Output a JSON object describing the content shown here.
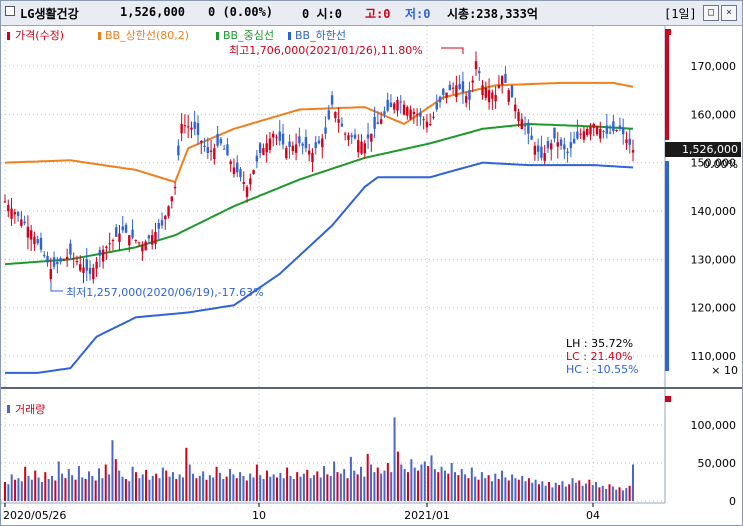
{
  "title_bar": {
    "stock_name": "LG생활건강",
    "price": "1,526,000",
    "change": "0 (0.00%)",
    "open_label": "0  시:0",
    "high_label": "고:0",
    "low_label": "저:0",
    "market_cap": "시총:238,333억",
    "period_button": "[1일]",
    "icon_restore": "restore-icon",
    "icon_close": "close-icon"
  },
  "colors": {
    "price": "#d0021b",
    "upper": "#f07f1f",
    "middle": "#1a9a2a",
    "lower": "#2f63d6",
    "volume": "#4a66c8",
    "grid": "#c0c8d4"
  },
  "legend": [
    {
      "label": "가격(수정)",
      "color": "#d0021b"
    },
    {
      "label": "BB_상한선(80,2)",
      "color": "#f07f1f"
    },
    {
      "label": "BB_중심선",
      "color": "#1a9a2a"
    },
    {
      "label": "BB_하한선",
      "color": "#2f63d6"
    }
  ],
  "annotations": {
    "max": "최고1,706,000(2021/01/26),11.80%",
    "min": "최저1,257,000(2020/06/19),-17.63%",
    "lh": "LH :  35.72%",
    "lc": "LC :  21.40%",
    "hc": "HC : -10.55%"
  },
  "price_axis": {
    "ticks": [
      "170,000",
      "160,000",
      "150,000",
      "140,000",
      "130,000",
      "120,000",
      "110,000"
    ],
    "multiplier": "× 10",
    "current": "1,526,000",
    "current_pct": "0.00%"
  },
  "volume_panel": {
    "legend": "거래량",
    "ticks": [
      "100,000",
      "50,000",
      "0"
    ]
  },
  "x_axis": {
    "labels": [
      "2020/05/26",
      "10",
      "2021/01",
      "04"
    ]
  },
  "chart_data": {
    "type": "line",
    "x_range": [
      "2020/05/26",
      "2021/04"
    ],
    "ylim": [
      104000,
      176000
    ],
    "volume_ylim": [
      0,
      120000
    ],
    "series": [
      {
        "name": "가격(수정)",
        "values": [
          [
            0,
            142000
          ],
          [
            8,
            136000
          ],
          [
            14,
            128000
          ],
          [
            20,
            131000
          ],
          [
            26,
            127000
          ],
          [
            30,
            132000
          ],
          [
            36,
            136000
          ],
          [
            42,
            133000
          ],
          [
            48,
            137000
          ],
          [
            52,
            145000
          ],
          [
            54,
            158000
          ],
          [
            58,
            157000
          ],
          [
            62,
            152000
          ],
          [
            66,
            154000
          ],
          [
            70,
            149000
          ],
          [
            74,
            145000
          ],
          [
            78,
            152000
          ],
          [
            82,
            156000
          ],
          [
            86,
            153000
          ],
          [
            90,
            154000
          ],
          [
            94,
            152000
          ],
          [
            98,
            156000
          ],
          [
            100,
            162000
          ],
          [
            104,
            156000
          ],
          [
            110,
            154000
          ],
          [
            116,
            160000
          ],
          [
            120,
            163000
          ],
          [
            126,
            160000
          ],
          [
            130,
            158000
          ],
          [
            134,
            164000
          ],
          [
            138,
            166000
          ],
          [
            142,
            163000
          ],
          [
            144,
            171000
          ],
          [
            146,
            166000
          ],
          [
            150,
            164000
          ],
          [
            152,
            168000
          ],
          [
            156,
            162000
          ],
          [
            160,
            156000
          ],
          [
            164,
            151000
          ],
          [
            168,
            155000
          ],
          [
            172,
            152000
          ],
          [
            176,
            156000
          ],
          [
            180,
            158000
          ],
          [
            184,
            156000
          ],
          [
            188,
            157000
          ],
          [
            192,
            152600
          ]
        ]
      },
      {
        "name": "BB_상한선(80,2)",
        "values": [
          [
            0,
            150000
          ],
          [
            20,
            150500
          ],
          [
            40,
            148500
          ],
          [
            52,
            146000
          ],
          [
            56,
            153000
          ],
          [
            70,
            157000
          ],
          [
            90,
            161000
          ],
          [
            110,
            161500
          ],
          [
            122,
            158000
          ],
          [
            134,
            163500
          ],
          [
            150,
            166000
          ],
          [
            170,
            166500
          ],
          [
            186,
            166500
          ],
          [
            192,
            165700
          ]
        ]
      },
      {
        "name": "BB_중심선",
        "values": [
          [
            0,
            129000
          ],
          [
            20,
            130000
          ],
          [
            40,
            132500
          ],
          [
            52,
            135000
          ],
          [
            70,
            141000
          ],
          [
            90,
            146500
          ],
          [
            110,
            151000
          ],
          [
            130,
            154000
          ],
          [
            146,
            157000
          ],
          [
            160,
            158000
          ],
          [
            180,
            157500
          ],
          [
            192,
            157000
          ]
        ]
      },
      {
        "name": "BB_하한선",
        "values": [
          [
            0,
            106500
          ],
          [
            10,
            106500
          ],
          [
            20,
            107500
          ],
          [
            28,
            114000
          ],
          [
            40,
            118000
          ],
          [
            56,
            119000
          ],
          [
            70,
            120500
          ],
          [
            84,
            127000
          ],
          [
            100,
            137000
          ],
          [
            110,
            145000
          ],
          [
            114,
            147000
          ],
          [
            130,
            147000
          ],
          [
            146,
            150000
          ],
          [
            160,
            149500
          ],
          [
            180,
            149500
          ],
          [
            192,
            149000
          ]
        ]
      }
    ],
    "volume_values": [
      25000,
      22000,
      35000,
      28000,
      30000,
      26000,
      45000,
      33000,
      28000,
      40000,
      31000,
      25000,
      38000,
      29000,
      33000,
      27000,
      52000,
      36000,
      30000,
      42000,
      34000,
      28000,
      46000,
      31000,
      29000,
      39000,
      33000,
      27000,
      43000,
      30000,
      48000,
      35000,
      80000,
      55000,
      40000,
      32000,
      29000,
      26000,
      45000,
      38000,
      30000,
      35000,
      41000,
      28000,
      33000,
      36000,
      30000,
      44000,
      40000,
      32000,
      38000,
      29000,
      35000,
      31000,
      70000,
      48000,
      36000,
      30000,
      33000,
      39000,
      28000,
      34000,
      31000,
      45000,
      37000,
      29000,
      32000,
      42000,
      35000,
      30000,
      38000,
      33000,
      27000,
      36000,
      31000,
      48000,
      34000,
      29000,
      40000,
      32000,
      35000,
      31000,
      37000,
      30000,
      44000,
      33000,
      29000,
      38000,
      32000,
      36000,
      41000,
      30000,
      34000,
      39000,
      31000,
      46000,
      35000,
      33000,
      52000,
      38000,
      36000,
      42000,
      30000,
      58000,
      40000,
      35000,
      45000,
      32000,
      62000,
      48000,
      38000,
      44000,
      36000,
      40000,
      50000,
      38000,
      110000,
      65000,
      48000,
      42000,
      38000,
      55000,
      44000,
      40000,
      48000,
      52000,
      46000,
      60000,
      42000,
      38000,
      45000,
      40000,
      36000,
      50000,
      38000,
      34000,
      42000,
      35000,
      30000,
      44000,
      32000,
      28000,
      38000,
      30000,
      34000,
      26000,
      36000,
      29000,
      40000,
      31000,
      27000,
      35000,
      30000,
      28000,
      33000,
      26000,
      30000,
      24000,
      28000,
      22000,
      26000,
      20000,
      25000,
      18000,
      24000,
      21000,
      26000,
      19000,
      22000,
      30000,
      24000,
      27000,
      20000,
      23000,
      28000,
      21000,
      25000,
      18000,
      20000,
      16000,
      22000,
      19000,
      15000,
      18000,
      14000,
      17000,
      20000,
      48000
    ]
  }
}
